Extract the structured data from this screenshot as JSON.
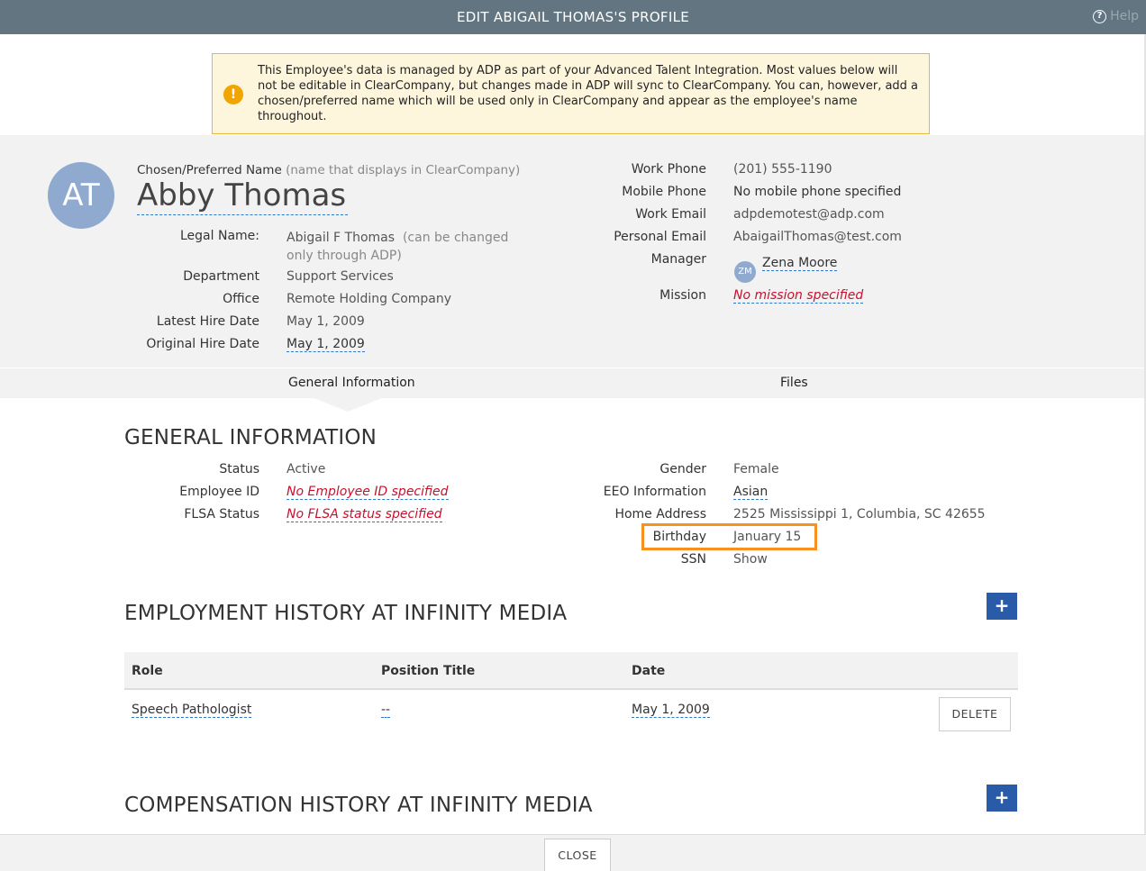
{
  "window": {
    "title": "EDIT ABIGAIL THOMAS'S PROFILE",
    "help_label": "Help"
  },
  "alert": {
    "icon": "exclamation-icon",
    "text": "This Employee's data is managed by ADP as part of your Advanced Talent Integration. Most values below will not be editable in ClearCompany, but changes made in ADP will sync to ClearCompany. You can, however, add a chosen/preferred name which will be used only in ClearCompany and appear as the employee's name throughout."
  },
  "profile": {
    "avatar_initials": "AT",
    "preferred_name_label": "Chosen/Preferred Name",
    "preferred_name_hint": "(name that displays in ClearCompany)",
    "display_name": "Abby Thomas",
    "left_fields": {
      "legal_name_label": "Legal Name:",
      "legal_name_value": "Abigail F Thomas",
      "legal_name_hint": "(can be changed only through ADP)",
      "department_label": "Department",
      "department_value": "Support Services",
      "office_label": "Office",
      "office_value": "Remote Holding Company",
      "latest_hire_label": "Latest Hire Date",
      "latest_hire_value": "May 1, 2009",
      "original_hire_label": "Original Hire Date",
      "original_hire_value": "May 1, 2009"
    },
    "right_fields": {
      "work_phone_label": "Work Phone",
      "work_phone_value": "(201) 555-1190",
      "mobile_phone_label": "Mobile Phone",
      "mobile_phone_value": "No mobile phone specified",
      "work_email_label": "Work Email",
      "work_email_value": "adpdemotest@adp.com",
      "personal_email_label": "Personal Email",
      "personal_email_value": "AbaigailThomas@test.com",
      "manager_label": "Manager",
      "manager_initials": "ZM",
      "manager_value": "Zena Moore",
      "mission_label": "Mission",
      "mission_value": "No mission specified"
    }
  },
  "tabs": [
    {
      "label": "General Information",
      "active": true
    },
    {
      "label": "Files",
      "active": false
    }
  ],
  "general": {
    "heading": "GENERAL INFORMATION",
    "status_label": "Status",
    "status_value": "Active",
    "employee_id_label": "Employee ID",
    "employee_id_value": "No Employee ID specified",
    "flsa_label": "FLSA Status",
    "flsa_value": "No FLSA status specified",
    "gender_label": "Gender",
    "gender_value": "Female",
    "eeo_label": "EEO Information",
    "eeo_value": "Asian",
    "address_label": "Home Address",
    "address_value": "2525 Mississippi 1, Columbia, SC 42655",
    "birthday_label": "Birthday",
    "birthday_value": "January 15",
    "ssn_label": "SSN",
    "ssn_value": "Show",
    "highlight_color": "#f7901e"
  },
  "employment": {
    "heading": "EMPLOYMENT HISTORY AT INFINITY MEDIA",
    "add_label": "+",
    "columns": [
      "Role",
      "Position Title",
      "Date"
    ],
    "rows": [
      {
        "role": "Speech Pathologist",
        "position_title": "--",
        "date": "May 1, 2009",
        "action": "DELETE"
      }
    ]
  },
  "compensation": {
    "heading": "COMPENSATION HISTORY AT INFINITY MEDIA",
    "add_label": "+"
  },
  "footer": {
    "close_label": "CLOSE"
  },
  "colors": {
    "titlebar": "#627580",
    "accent_blue": "#2a5ba9",
    "error_red": "#c8102e",
    "alert_bg": "#fdf6dd",
    "alert_border": "#e7b63e"
  }
}
